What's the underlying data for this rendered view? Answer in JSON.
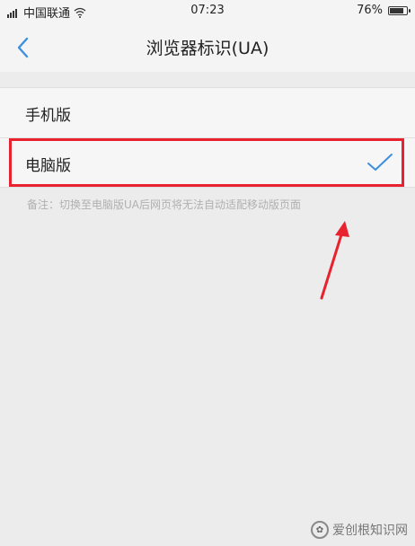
{
  "status_bar": {
    "carrier": "中国联通",
    "time": "07:23",
    "battery": "76%",
    "battery_level": 0.76
  },
  "nav": {
    "title": "浏览器标识(UA)"
  },
  "options": [
    {
      "label": "手机版",
      "selected": false
    },
    {
      "label": "电脑版",
      "selected": true
    }
  ],
  "note": "备注：切换至电脑版UA后网页将无法自动适配移动版页面",
  "colors": {
    "accent": "#3d8fe0",
    "highlight": "#e8232f",
    "background": "#ececec"
  },
  "watermark": {
    "text": "爱创根知识网"
  }
}
